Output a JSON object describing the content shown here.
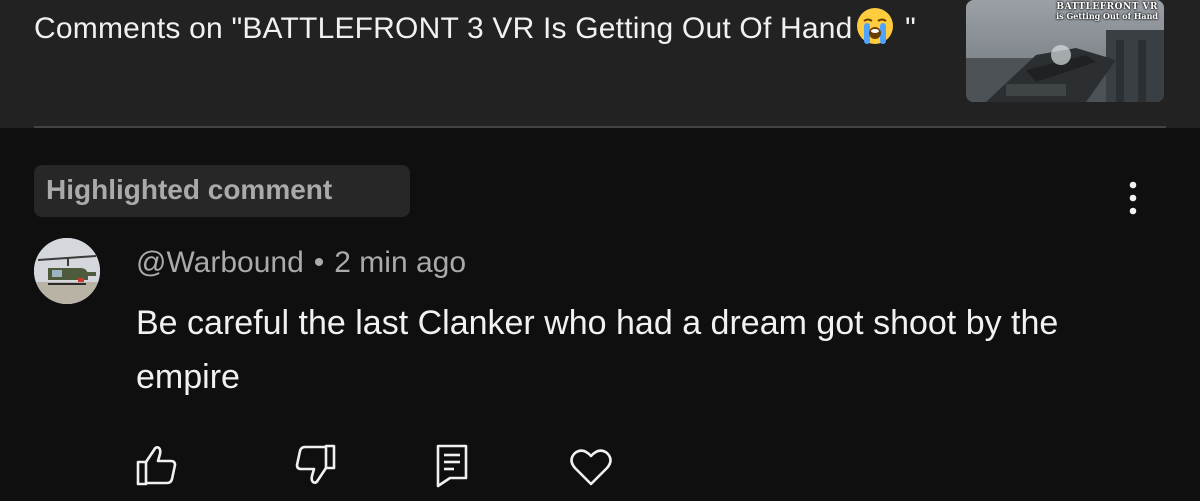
{
  "header": {
    "title_prefix": "Comments on \"BATTLEFRONT 3 VR Is Getting Out Of Hand",
    "title_suffix": " \"",
    "title_emoji_name": "loudly-crying-face-emoji",
    "thumbnail": {
      "caption_line1": "BATTLEFRONT VR",
      "caption_line2": "is Getting Out of Hand"
    }
  },
  "comment": {
    "highlight_label": "Highlighted comment",
    "author": "@Warbound",
    "separator": "•",
    "timestamp": "2 min ago",
    "text": "Be careful the last Clanker who had a dream got shoot by the empire"
  },
  "actions": [
    {
      "name": "like",
      "icon": "thumbs-up-icon"
    },
    {
      "name": "dislike",
      "icon": "thumbs-down-icon"
    },
    {
      "name": "reply",
      "icon": "comment-reply-icon"
    },
    {
      "name": "heart",
      "icon": "heart-icon"
    }
  ],
  "colors": {
    "background": "#0f0f0f",
    "header_background": "#222222",
    "chip_background": "#272727",
    "primary_text": "#f1f1f1",
    "secondary_text": "#aaaaaa"
  }
}
